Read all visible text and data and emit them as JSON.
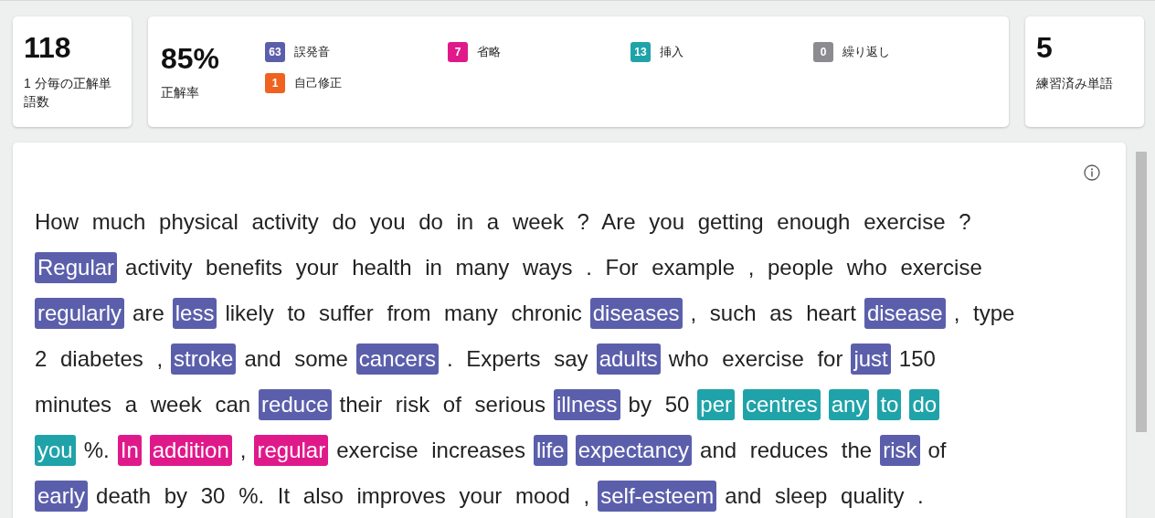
{
  "stats": [
    {
      "value": "118",
      "label": "1 分毎の正解単語数"
    }
  ],
  "accuracy": {
    "value": "85%",
    "label": "正解率",
    "legend": [
      {
        "count": "63",
        "label": "誤発音",
        "kind": "mispronunciation"
      },
      {
        "count": "7",
        "label": "省略",
        "kind": "omission"
      },
      {
        "count": "13",
        "label": "挿入",
        "kind": "insertion"
      },
      {
        "count": "0",
        "label": "繰り返し",
        "kind": "repetition"
      },
      {
        "count": "1",
        "label": "自己修正",
        "kind": "selfcorrection"
      }
    ]
  },
  "practiced": {
    "value": "5",
    "label": "練習済み単語"
  },
  "passage": {
    "lines": [
      [
        {
          "text": "How much physical activity do you do in a week ? Are you getting enough exercise ?",
          "kind": "plain"
        }
      ],
      [
        {
          "text": "Regular",
          "kind": "mispronunciation"
        },
        {
          "text": "activity benefits your health in many ways . For example , people who exercise",
          "kind": "plain"
        }
      ],
      [
        {
          "text": "regularly",
          "kind": "mispronunciation"
        },
        {
          "text": "are",
          "kind": "plain"
        },
        {
          "text": "less",
          "kind": "mispronunciation"
        },
        {
          "text": "likely to suffer from many chronic",
          "kind": "plain"
        },
        {
          "text": "diseases",
          "kind": "mispronunciation"
        },
        {
          "text": ", such as heart",
          "kind": "plain"
        },
        {
          "text": "disease",
          "kind": "mispronunciation"
        },
        {
          "text": ", type",
          "kind": "plain"
        }
      ],
      [
        {
          "text": "2 diabetes ,",
          "kind": "plain"
        },
        {
          "text": "stroke",
          "kind": "mispronunciation"
        },
        {
          "text": "and some",
          "kind": "plain"
        },
        {
          "text": "cancers",
          "kind": "mispronunciation"
        },
        {
          "text": ". Experts say",
          "kind": "plain"
        },
        {
          "text": "adults",
          "kind": "mispronunciation"
        },
        {
          "text": "who exercise for",
          "kind": "plain"
        },
        {
          "text": "just",
          "kind": "mispronunciation"
        },
        {
          "text": "150",
          "kind": "plain"
        }
      ],
      [
        {
          "text": "minutes a week can",
          "kind": "plain"
        },
        {
          "text": "reduce",
          "kind": "mispronunciation"
        },
        {
          "text": "their risk of serious",
          "kind": "plain"
        },
        {
          "text": "illness",
          "kind": "mispronunciation"
        },
        {
          "text": "by 50",
          "kind": "plain"
        },
        {
          "text": "per",
          "kind": "insertion"
        },
        {
          "text": "centres",
          "kind": "insertion"
        },
        {
          "text": "any",
          "kind": "insertion"
        },
        {
          "text": "to",
          "kind": "insertion"
        },
        {
          "text": "do",
          "kind": "insertion"
        }
      ],
      [
        {
          "text": "you",
          "kind": "insertion"
        },
        {
          "text": "%.",
          "kind": "plain"
        },
        {
          "text": "In",
          "kind": "omission"
        },
        {
          "text": "addition",
          "kind": "omission"
        },
        {
          "text": ",",
          "kind": "plain"
        },
        {
          "text": "regular",
          "kind": "omission"
        },
        {
          "text": "exercise increases",
          "kind": "plain"
        },
        {
          "text": "life",
          "kind": "mispronunciation"
        },
        {
          "text": "expectancy",
          "kind": "mispronunciation"
        },
        {
          "text": "and reduces the",
          "kind": "plain"
        },
        {
          "text": "risk",
          "kind": "mispronunciation"
        },
        {
          "text": "of",
          "kind": "plain"
        }
      ],
      [
        {
          "text": "early",
          "kind": "mispronunciation"
        },
        {
          "text": "death by 30 %. It also improves your mood ,",
          "kind": "plain"
        },
        {
          "text": "self-esteem",
          "kind": "mispronunciation"
        },
        {
          "text": "and sleep quality .",
          "kind": "plain"
        }
      ]
    ]
  }
}
